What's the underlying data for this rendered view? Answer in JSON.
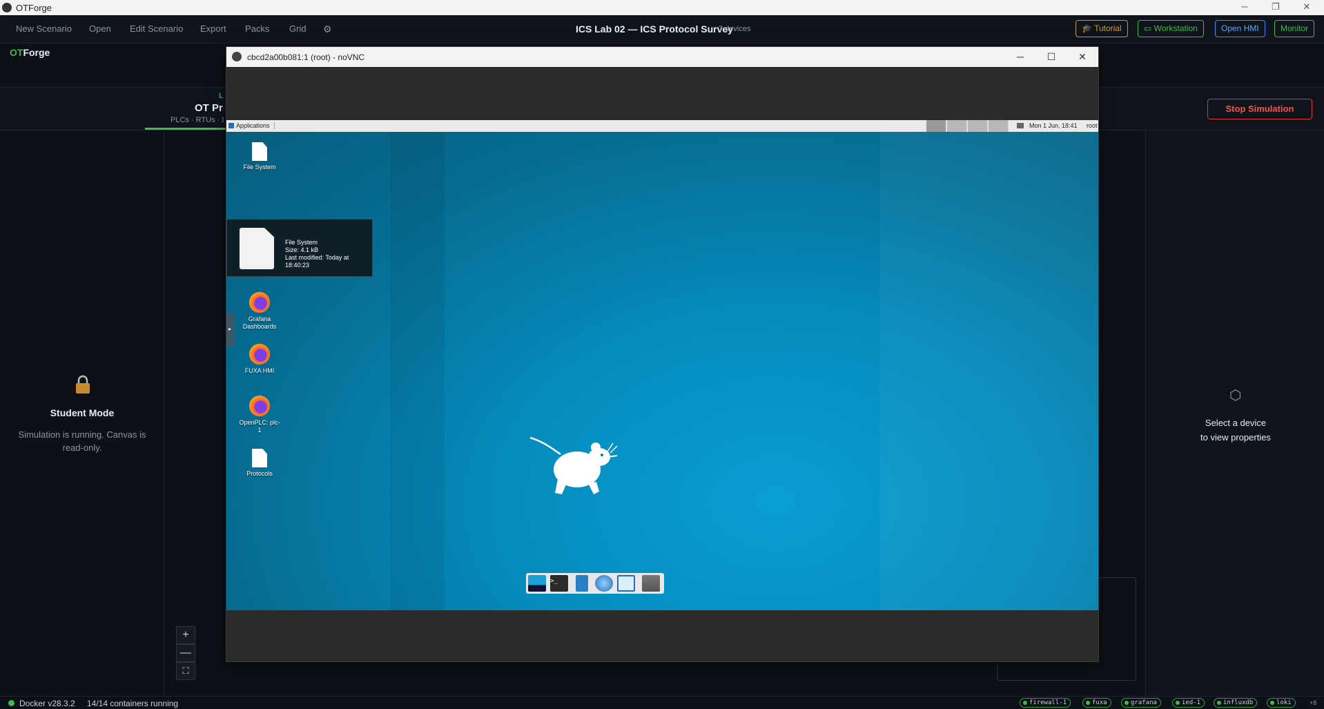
{
  "os_window": {
    "title": "OTForge",
    "controls": [
      "─",
      "❐",
      "✕"
    ]
  },
  "menu": {
    "items": [
      "New Scenario",
      "Open",
      "Edit Scenario",
      "Export",
      "Packs",
      "Grid"
    ],
    "settings_icon": "gear-icon"
  },
  "scenario": {
    "title": "ICS Lab 02 — ICS Protocol Survey",
    "devices": "7 devices"
  },
  "header_buttons": {
    "tutorial": "Tutorial",
    "workstation": "Workstation",
    "open_hmi": "Open HMI",
    "monitor": "Monitor"
  },
  "brand": {
    "accent": "OT",
    "rest": "Forge"
  },
  "layer_tab": {
    "label": "L",
    "title": "OT Pr",
    "subtitle": "PLCs · RTUs · I"
  },
  "stop_button": "Stop Simulation",
  "left_panel": {
    "title": "Student Mode",
    "text": "Simulation is running. Canvas is read-only."
  },
  "right_panel": {
    "icon": "⬡",
    "line1": "Select a device",
    "line2": "to view properties"
  },
  "zoom": {
    "in": "+",
    "out": "—",
    "fit": "⛶"
  },
  "status": {
    "docker": "Docker v28.3.2",
    "containers": "14/14 containers running",
    "chips": [
      "firewall-1",
      "fuxa",
      "grafana",
      "ied-1",
      "influxdb",
      "loki"
    ],
    "more": "+8"
  },
  "vnc": {
    "title": "cbcd2a00b081:1 (root) - noVNC",
    "panel": {
      "menu": "Applications",
      "clock": "Mon  1 Jun, 18:41",
      "user": "root"
    },
    "desktop_icons": [
      {
        "label": "File System",
        "kind": "file"
      },
      {
        "label": "Grafana Dashboards",
        "kind": "firefox"
      },
      {
        "label": "FUXA HMI",
        "kind": "firefox"
      },
      {
        "label": "OpenPLC: plc-1",
        "kind": "firefox"
      },
      {
        "label": "Protocols",
        "kind": "file"
      }
    ],
    "tooltip": {
      "name": "File System",
      "size": "Size: 4.1 kB",
      "modified": "Last modified: Today at 18:40:23"
    }
  },
  "colors": {
    "accent_green": "#3fb950",
    "tutorial": "#d29922",
    "open_hmi": "#388bfd",
    "stop": "#f85149"
  }
}
